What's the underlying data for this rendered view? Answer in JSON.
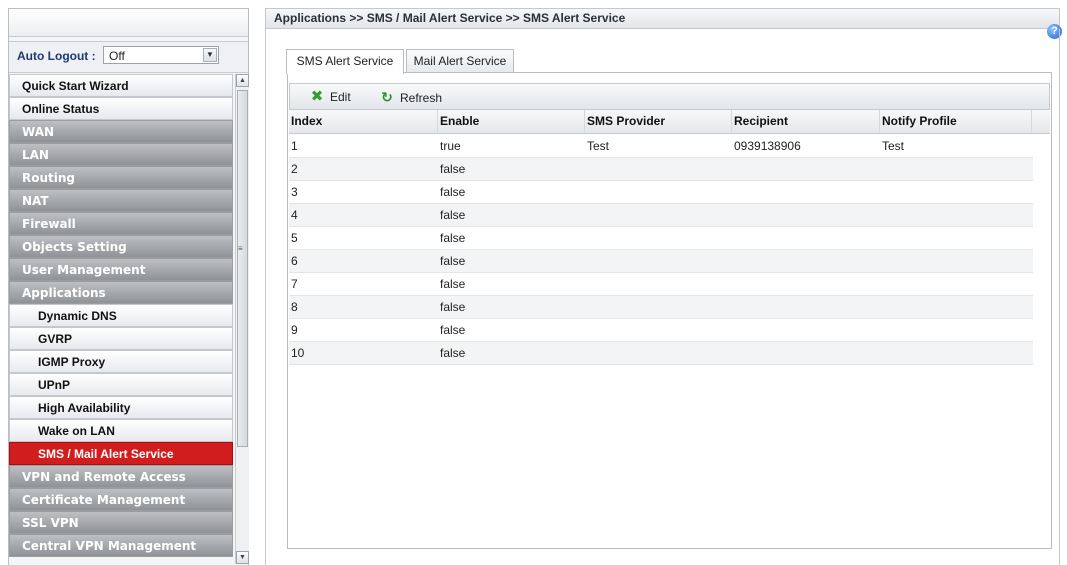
{
  "sidebar": {
    "auto_logout_label": "Auto Logout :",
    "auto_logout_value": "Off",
    "items": [
      {
        "label": "Quick Start Wizard"
      },
      {
        "label": "Online Status"
      },
      {
        "label": "WAN"
      },
      {
        "label": "LAN"
      },
      {
        "label": "Routing"
      },
      {
        "label": "NAT"
      },
      {
        "label": "Firewall"
      },
      {
        "label": "Objects Setting"
      },
      {
        "label": "User Management"
      },
      {
        "label": "Applications"
      },
      {
        "label": "Dynamic DNS"
      },
      {
        "label": "GVRP"
      },
      {
        "label": "IGMP Proxy"
      },
      {
        "label": "UPnP"
      },
      {
        "label": "High Availability"
      },
      {
        "label": "Wake on LAN"
      },
      {
        "label": "SMS / Mail Alert Service"
      },
      {
        "label": "VPN and Remote Access"
      },
      {
        "label": "Certificate Management"
      },
      {
        "label": "SSL VPN"
      },
      {
        "label": "Central VPN Management"
      }
    ]
  },
  "header": {
    "breadcrumb": "Applications >> SMS / Mail Alert Service >> SMS Alert Service",
    "help_icon": "?"
  },
  "tabs": [
    {
      "label": "SMS Alert Service"
    },
    {
      "label": "Mail Alert Service"
    }
  ],
  "toolbar": {
    "edit_label": "Edit",
    "refresh_label": "Refresh"
  },
  "table": {
    "columns": [
      "Index",
      "Enable",
      "SMS Provider",
      "Recipient",
      "Notify Profile"
    ],
    "rows": [
      [
        "1",
        "true",
        "Test",
        "0939138906",
        "Test"
      ],
      [
        "2",
        "false",
        "",
        "",
        ""
      ],
      [
        "3",
        "false",
        "",
        "",
        ""
      ],
      [
        "4",
        "false",
        "",
        "",
        ""
      ],
      [
        "5",
        "false",
        "",
        "",
        ""
      ],
      [
        "6",
        "false",
        "",
        "",
        ""
      ],
      [
        "7",
        "false",
        "",
        "",
        ""
      ],
      [
        "8",
        "false",
        "",
        "",
        ""
      ],
      [
        "9",
        "false",
        "",
        "",
        ""
      ],
      [
        "10",
        "false",
        "",
        "",
        ""
      ]
    ]
  },
  "colors": {
    "active_menu": "#d11d1d",
    "dark_menu": "#9a9da2",
    "accent_green": "#2f9e2f"
  }
}
